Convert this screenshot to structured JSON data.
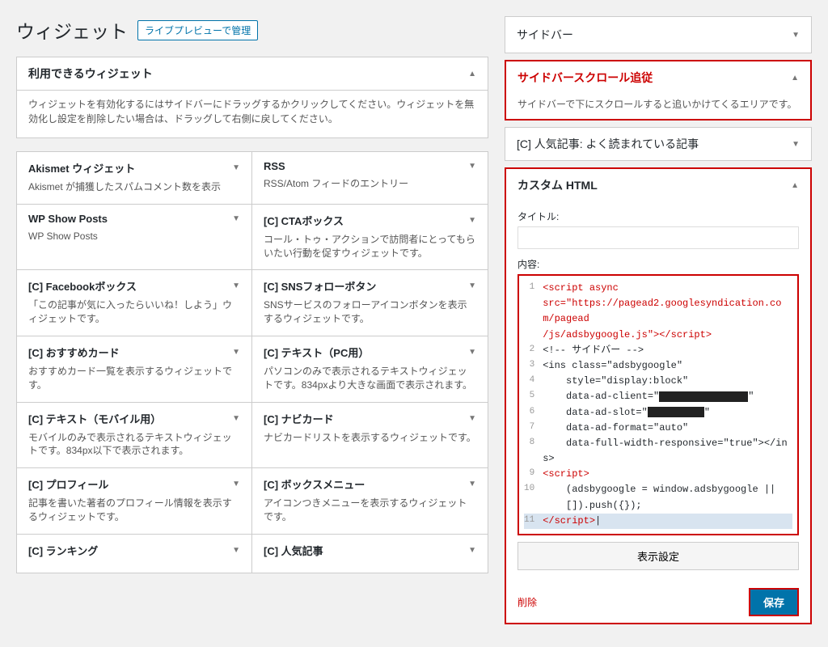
{
  "page": {
    "title": "ウィジェット",
    "live_preview_btn": "ライブプレビューで管理"
  },
  "left": {
    "section_title": "利用できるウィジェット",
    "section_desc": "ウィジェットを有効化するにはサイドバーにドラッグするかクリックしてください。ウィジェットを無効化し設定を削除したい場合は、ドラッグして右側に戻してください。",
    "widgets": [
      {
        "name": "Akismet ウィジェット",
        "desc": "Akismet が捕獲したスパムコメント数を表示"
      },
      {
        "name": "RSS",
        "desc": "RSS/Atom フィードのエントリー"
      },
      {
        "name": "WP Show Posts",
        "desc": "WP Show Posts"
      },
      {
        "name": "[C] CTAボックス",
        "desc": "コール・トゥ・アクションで訪問者にとってもらいたい行動を促すウィジェットです。"
      },
      {
        "name": "[C] Facebookボックス",
        "desc": "「この記事が気に入ったらいいね！しよう」ウィジェットです。"
      },
      {
        "name": "[C] SNSフォローボタン",
        "desc": "SNSサービスのフォローアイコンボタンを表示するウィジェットです。"
      },
      {
        "name": "[C] おすすめカード",
        "desc": "おすすめカード一覧を表示するウィジェットです。"
      },
      {
        "name": "[C] テキスト（PC用）",
        "desc": "パソコンのみで表示されるテキストウィジェットです。834pxより大きな画面で表示されます。"
      },
      {
        "name": "[C] テキスト（モバイル用）",
        "desc": "モバイルのみで表示されるテキストウィジェットです。834px以下で表示されます。"
      },
      {
        "name": "[C] ナビカード",
        "desc": "ナビカードリストを表示するウィジェットです。"
      },
      {
        "name": "[C] プロフィール",
        "desc": "記事を書いた著者のプロフィール情報を表示するウィジェットです。"
      },
      {
        "name": "[C] ボックスメニュー",
        "desc": "アイコンつきメニューを表示するウィジェットです。"
      },
      {
        "name": "[C] ランキング",
        "desc": ""
      },
      {
        "name": "[C] 人気記事",
        "desc": ""
      }
    ]
  },
  "right": {
    "sidebar_label": "サイドバー",
    "scroll_widget": {
      "title": "サイドバースクロール追従",
      "desc": "サイドバーで下にスクロールすると追いかけてくるエリアです。"
    },
    "popular_widget": {
      "title": "[C] 人気記事: よく読まれている記事"
    },
    "custom_html": {
      "title": "カスタム HTML",
      "title_field_label": "タイトル:",
      "title_field_value": "",
      "content_field_label": "内容:",
      "display_settings_btn": "表示設定",
      "delete_link": "削除",
      "save_btn": "保存",
      "code_lines": [
        {
          "num": 1,
          "html": "<span class='code-red'>&lt;script async</span>"
        },
        {
          "num": "",
          "html": "<span class='code-red'>src=\"https://pagead2.googlesyndication.com/pagead</span>"
        },
        {
          "num": "",
          "html": "<span class='code-red'>/js/adsbygoogle.js\"&gt;&lt;/script&gt;</span>"
        },
        {
          "num": 2,
          "html": "<span class='code-dark'>&lt;!-- サイドバー --&gt;</span>"
        },
        {
          "num": 3,
          "html": "<span class='code-dark'>&lt;ins class=\"adsbygoogle\"</span>"
        },
        {
          "num": 4,
          "html": "<span class='code-dark'>    style=\"display:block\"</span>"
        },
        {
          "num": 5,
          "html": "<span class='code-dark'>    data-ad-client=\"</span><span class='code-black-bar'>&nbsp;&nbsp;&nbsp;&nbsp;&nbsp;&nbsp;&nbsp;&nbsp;&nbsp;&nbsp;&nbsp;&nbsp;&nbsp;&nbsp;</span><span class='code-dark'>\"</span>"
        },
        {
          "num": 6,
          "html": "<span class='code-dark'>    data-ad-slot=\"</span><span class='code-black-bar' style='min-width:60px'>&nbsp;&nbsp;&nbsp;&nbsp;&nbsp;&nbsp;</span><span class='code-dark'>\"</span>"
        },
        {
          "num": 7,
          "html": "<span class='code-dark'>    data-ad-format=\"auto\"</span>"
        },
        {
          "num": 8,
          "html": "<span class='code-dark'>    data-full-width-responsive=\"true\"&gt;&lt;/ins&gt;</span>"
        },
        {
          "num": 9,
          "html": "<span class='code-red'>&lt;script&gt;</span>"
        },
        {
          "num": 10,
          "html": "<span class='code-dark'>    (adsbygoogle = window.adsbygoogle ||</span>"
        },
        {
          "num": "",
          "html": "<span class='code-dark'>    []).push({});</span>"
        },
        {
          "num": 11,
          "html": "<span class='code-red'>&lt;/script&gt;</span>"
        }
      ]
    }
  }
}
